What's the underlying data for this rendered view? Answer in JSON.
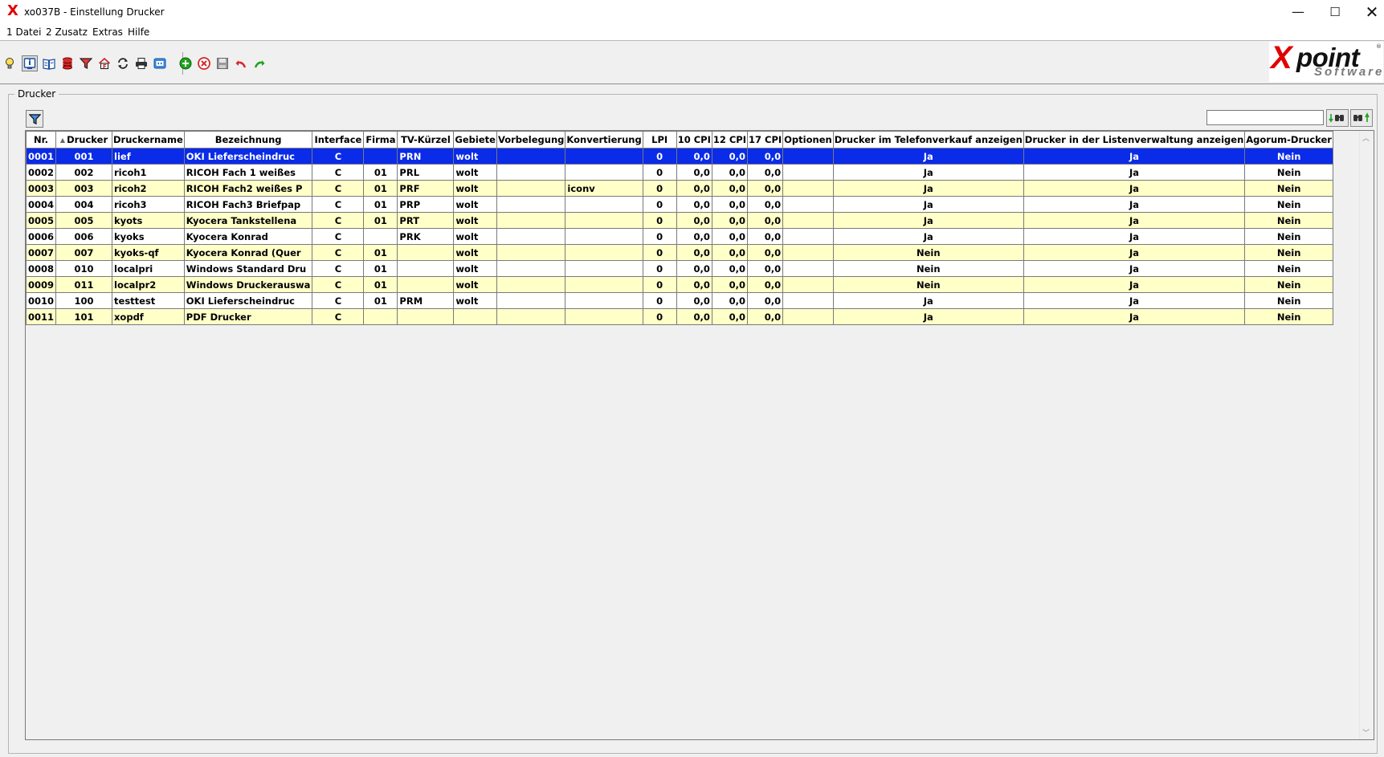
{
  "window": {
    "title": "xo037B - Einstellung Drucker",
    "app_icon_glyph": "X",
    "minimize": "—",
    "maximize": "☐",
    "close": "✕"
  },
  "menu": [
    "1 Datei",
    "2 Zusatz",
    "Extras",
    "Hilfe"
  ],
  "toolbar": {
    "icons": [
      "info-bulb-icon",
      "info-window-icon",
      "book-icon",
      "database-icon",
      "filter-icon",
      "home-form-icon",
      "refresh-icon",
      "printer-icon",
      "screen-icon",
      "add-icon",
      "delete-icon",
      "save-icon",
      "undo-icon",
      "redo-icon"
    ]
  },
  "logo": {
    "x": "X",
    "point": "point",
    "software": "Software",
    "reg": "®"
  },
  "group": {
    "label": "Drucker"
  },
  "search": {
    "value": "",
    "placeholder": ""
  },
  "colors": {
    "selected_row": "#0a2be8",
    "even_row": "#ffffc8",
    "odd_row": "#ffffff",
    "brand_red": "#e00000"
  },
  "table": {
    "columns": [
      "Nr.",
      "Drucker",
      "Druckername",
      "Bezeichnung",
      "Interface",
      "Firma",
      "TV-Kürzel",
      "Gebiete",
      "Vorbelegung",
      "Konvertierung",
      "LPI",
      "10 CPI",
      "12 CPI",
      "17 CPI",
      "Optionen",
      "Drucker im Telefonverkauf anzeigen",
      "Drucker in der Listenverwaltung anzeigen",
      "Agorum-Drucker"
    ],
    "sorted_column": "Drucker",
    "selected_row": 0,
    "rows": [
      [
        "0001",
        "001",
        "lief",
        "OKI Lieferscheindruc",
        "C",
        "",
        "PRN",
        "wolt",
        "",
        "",
        "0",
        "0,0",
        "0,0",
        "0,0",
        "",
        "Ja",
        "Ja",
        "Nein"
      ],
      [
        "0002",
        "002",
        "ricoh1",
        "RICOH Fach 1 weißes",
        "C",
        "01",
        "PRL",
        "wolt",
        "",
        "",
        "0",
        "0,0",
        "0,0",
        "0,0",
        "",
        "Ja",
        "Ja",
        "Nein"
      ],
      [
        "0003",
        "003",
        "ricoh2",
        "RICOH Fach2 weißes P",
        "C",
        "01",
        "PRF",
        "wolt",
        "",
        "iconv",
        "0",
        "0,0",
        "0,0",
        "0,0",
        "",
        "Ja",
        "Ja",
        "Nein"
      ],
      [
        "0004",
        "004",
        "ricoh3",
        "RICOH Fach3 Briefpap",
        "C",
        "01",
        "PRP",
        "wolt",
        "",
        "",
        "0",
        "0,0",
        "0,0",
        "0,0",
        "",
        "Ja",
        "Ja",
        "Nein"
      ],
      [
        "0005",
        "005",
        "kyots",
        "Kyocera Tankstellena",
        "C",
        "01",
        "PRT",
        "wolt",
        "",
        "",
        "0",
        "0,0",
        "0,0",
        "0,0",
        "",
        "Ja",
        "Ja",
        "Nein"
      ],
      [
        "0006",
        "006",
        "kyoks",
        "Kyocera Konrad",
        "C",
        "",
        "PRK",
        "wolt",
        "",
        "",
        "0",
        "0,0",
        "0,0",
        "0,0",
        "",
        "Ja",
        "Ja",
        "Nein"
      ],
      [
        "0007",
        "007",
        "kyoks-qf",
        "Kyocera Konrad (Quer",
        "C",
        "01",
        "",
        "wolt",
        "",
        "",
        "0",
        "0,0",
        "0,0",
        "0,0",
        "",
        "Nein",
        "Ja",
        "Nein"
      ],
      [
        "0008",
        "010",
        "localpri",
        "Windows Standard Dru",
        "C",
        "01",
        "",
        "wolt",
        "",
        "",
        "0",
        "0,0",
        "0,0",
        "0,0",
        "",
        "Nein",
        "Ja",
        "Nein"
      ],
      [
        "0009",
        "011",
        "localpr2",
        "Windows Druckerauswa",
        "C",
        "01",
        "",
        "wolt",
        "",
        "",
        "0",
        "0,0",
        "0,0",
        "0,0",
        "",
        "Nein",
        "Ja",
        "Nein"
      ],
      [
        "0010",
        "100",
        "testtest",
        "OKI Lieferscheindruc",
        "C",
        "01",
        "PRM",
        "wolt",
        "",
        "",
        "0",
        "0,0",
        "0,0",
        "0,0",
        "",
        "Ja",
        "Ja",
        "Nein"
      ],
      [
        "0011",
        "101",
        "xopdf",
        "PDF Drucker",
        "C",
        "",
        "",
        "",
        "",
        "",
        "0",
        "0,0",
        "0,0",
        "0,0",
        "",
        "Ja",
        "Ja",
        "Nein"
      ]
    ]
  }
}
